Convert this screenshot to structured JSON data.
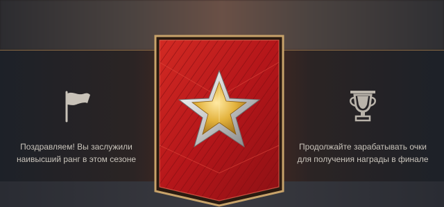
{
  "left_panel": {
    "icon": "flag-icon",
    "message": "Поздравляем! Вы заслужили наивысший ранг в этом сезоне"
  },
  "right_panel": {
    "icon": "trophy-icon",
    "message": "Продолжайте зарабатывать очки для получения награды в финале"
  },
  "rank_badge": {
    "icon": "star-icon",
    "colors": {
      "banner": "#c0161a",
      "trim": "#c8a36a",
      "star": "#e3b23c",
      "star_rim": "#d8d8d8"
    }
  }
}
